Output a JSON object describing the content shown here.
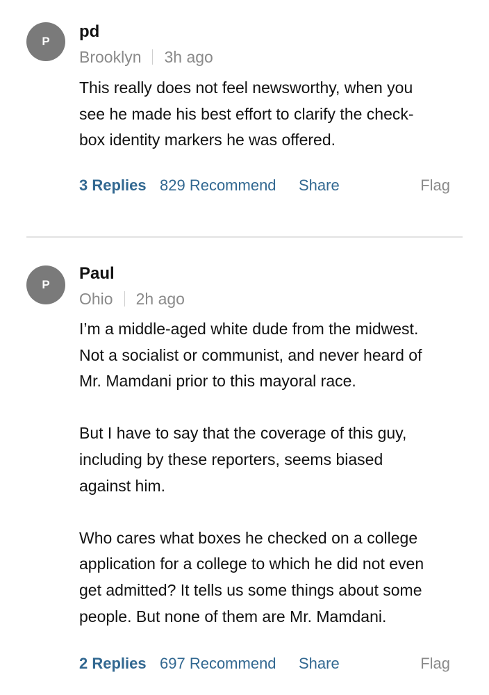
{
  "comments": [
    {
      "avatar_initial": "P",
      "author": "pd",
      "location": "Brooklyn",
      "time": "3h ago",
      "paragraphs": [
        "This really does not feel newsworthy, when you\nsee he made his best effort to clarify the check-\nbox identity markers he was offered."
      ],
      "replies_label": "3 Replies",
      "recommend_label": "829 Recommend",
      "share_label": "Share",
      "flag_label": "Flag"
    },
    {
      "avatar_initial": "P",
      "author": "Paul",
      "location": "Ohio",
      "time": "2h ago",
      "paragraphs": [
        "I’m a middle-aged white dude from the midwest.\nNot a socialist or communist, and never heard of\nMr. Mamdani prior to this mayoral race.",
        "But I have to say that the coverage of this guy,\nincluding by these reporters, seems biased\nagainst him.",
        "Who cares what boxes he checked on a college\napplication for a college to which he did not even\nget admitted? It tells us some things about some\npeople. But none of them are Mr. Mamdani."
      ],
      "replies_label": "2 Replies",
      "recommend_label": "697 Recommend",
      "share_label": "Share",
      "flag_label": "Flag"
    }
  ],
  "colors": {
    "link": "#326891",
    "muted": "#8a8a8a",
    "avatar_bg": "#7a7a7a",
    "divider": "#e2e2e2"
  }
}
